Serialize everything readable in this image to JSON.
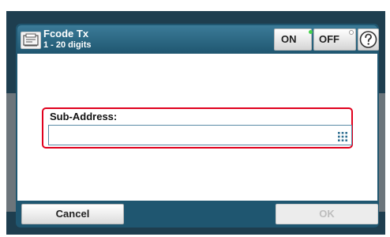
{
  "header": {
    "title": "Fcode Tx",
    "subtitle": "1 - 20 digits",
    "icon": "fax-icon"
  },
  "toggle": {
    "on_label": "ON",
    "off_label": "OFF",
    "on_led_color": "#46d24b"
  },
  "help": {
    "icon": "help-icon"
  },
  "field": {
    "label": "Sub-Address:",
    "value": "",
    "keypad_icon": "keypad-icon"
  },
  "footer": {
    "cancel_label": "Cancel",
    "ok_label": "OK"
  },
  "colors": {
    "panel": "#1f5670",
    "highlight": "#e0001d"
  }
}
